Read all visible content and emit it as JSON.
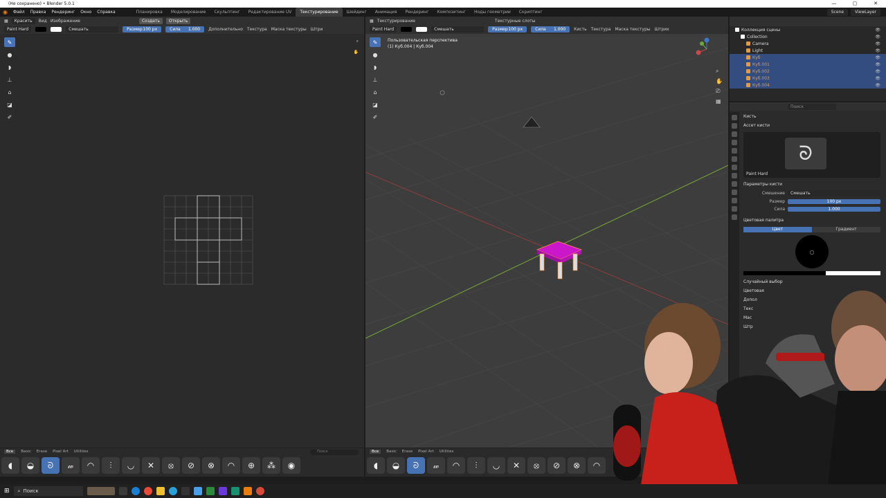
{
  "titlebar": {
    "title": "(Не сохранено) • Blender 5.0.1",
    "min": "—",
    "max": "▢",
    "close": "✕"
  },
  "menu": [
    "Файл",
    "Правка",
    "Рендеринг",
    "Окно",
    "Справка"
  ],
  "workspaces": [
    {
      "label": "Планировка",
      "active": false
    },
    {
      "label": "Моделирование",
      "active": false
    },
    {
      "label": "Скульптинг",
      "active": false
    },
    {
      "label": "Редактирование UV",
      "active": false
    },
    {
      "label": "Текстурирование",
      "active": true
    },
    {
      "label": "Шейдинг",
      "active": false
    },
    {
      "label": "Анимация",
      "active": false
    },
    {
      "label": "Рендеринг",
      "active": false
    },
    {
      "label": "Композитинг",
      "active": false
    },
    {
      "label": "Ноды геометрии",
      "active": false
    },
    {
      "label": "Скриптинг",
      "active": false
    }
  ],
  "topright": {
    "scene": "Scene",
    "viewlayer": "ViewLayer"
  },
  "image_editor": {
    "mode": "Красить",
    "view": "Вид",
    "image": "Изображение",
    "new_btn": "Создать",
    "open_btn": "Открыть",
    "brush": "Paint Hard",
    "blend": "Смешать",
    "size_label": "Размер",
    "size_value": "100 px",
    "strength_label": "Сила",
    "strength_value": "1.000",
    "advanced": "Дополнительно",
    "texture": "Текстура",
    "mask": "Маска текстуры",
    "more": "Штри"
  },
  "viewport": {
    "mode": "Текстурирование",
    "brush": "Paint Hard",
    "blend": "Смешать",
    "size_label": "Размер",
    "size_value": "100 px",
    "strength_label": "Сила",
    "strength_value": "1.000",
    "brush_menu": "Кисть",
    "texture": "Текстура",
    "mask": "Маска текстуры",
    "stroke": "Штрих",
    "slots": "Текстурные слоты",
    "overlay1": "Пользовательская перспектива",
    "overlay2": "(1) Куб.004 | Куб.004"
  },
  "outliner": {
    "items": [
      {
        "label": "Коллекция сцены",
        "color": "#ffffff",
        "sel": false,
        "indent": 0
      },
      {
        "label": "Collection",
        "color": "#ffffff",
        "sel": false,
        "indent": 1
      },
      {
        "label": "Camera",
        "color": "#e09a4a",
        "sel": false,
        "indent": 2
      },
      {
        "label": "Light",
        "color": "#e09a4a",
        "sel": false,
        "indent": 2
      },
      {
        "label": "Куб",
        "color": "#e09a4a",
        "sel": true,
        "indent": 2
      },
      {
        "label": "Куб.001",
        "color": "#e09a4a",
        "sel": true,
        "indent": 2
      },
      {
        "label": "Куб.002",
        "color": "#e09a4a",
        "sel": true,
        "indent": 2
      },
      {
        "label": "Куб.003",
        "color": "#e09a4a",
        "sel": true,
        "indent": 2
      },
      {
        "label": "Куб.004",
        "color": "#e09a4a",
        "sel": true,
        "indent": 2
      }
    ]
  },
  "properties": {
    "search_placeholder": "Поиск",
    "brush_title": "Кисть",
    "asset_section": "Ассет кисти",
    "brush_name": "Paint Hard",
    "params_section": "Параметры кисти",
    "blend_label": "Смешение",
    "blend_value": "Смешать",
    "size_label": "Размер",
    "size_value": "100 px",
    "strength_label": "Сила",
    "strength_value": "1.000",
    "palette_section": "Цветовая палитра",
    "tab_color": "Цвет",
    "tab_gradient": "Градиент",
    "random_section": "Случайный выбор",
    "color_label": "Цветовая",
    "extra1": "Допол",
    "extra2": "Текс",
    "extra3": "Mас",
    "extra4": "Штр"
  },
  "shelf": {
    "tabs": [
      "Все",
      "Basic",
      "Erase",
      "Pixel Art",
      "Utilities"
    ],
    "search_placeholder": "Поиск"
  },
  "taskbar": {
    "search": "Поиск"
  }
}
